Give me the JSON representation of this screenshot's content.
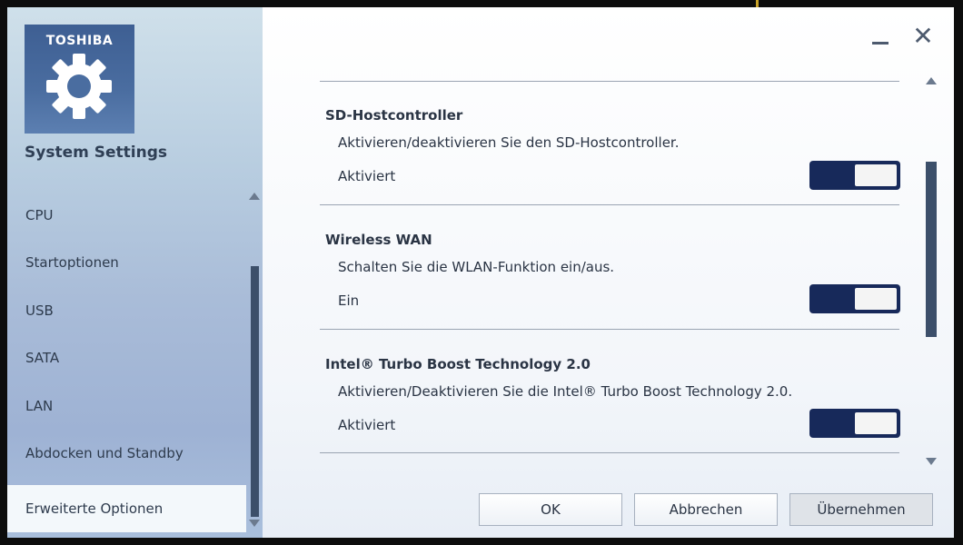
{
  "sidebar": {
    "logo_brand": "TOSHIBA",
    "app_title": "System Settings",
    "items": [
      {
        "label": "CPU"
      },
      {
        "label": "Startoptionen"
      },
      {
        "label": "USB"
      },
      {
        "label": "SATA"
      },
      {
        "label": "LAN"
      },
      {
        "label": "Abdocken und Standby"
      },
      {
        "label": "Erweiterte Optionen"
      }
    ],
    "selected_index": 6
  },
  "sections": [
    {
      "title": "SD-Hostcontroller",
      "description": "Aktivieren/deaktivieren Sie den SD-Hostcontroller.",
      "status": "Aktiviert",
      "toggle_on": true
    },
    {
      "title": "Wireless WAN",
      "description": "Schalten Sie die WLAN-Funktion ein/aus.",
      "status": "Ein",
      "toggle_on": true
    },
    {
      "title": "Intel® Turbo Boost Technology 2.0",
      "description": "Aktivieren/Deaktivieren Sie die Intel® Turbo Boost Technology 2.0.",
      "status": "Aktiviert",
      "toggle_on": true
    }
  ],
  "buttons": {
    "ok": "OK",
    "cancel": "Abbrechen",
    "apply": "Übernehmen"
  },
  "colors": {
    "toggle": "#17295a",
    "scrollbar": "#3c4f6a",
    "logo": "#4a6da0"
  }
}
